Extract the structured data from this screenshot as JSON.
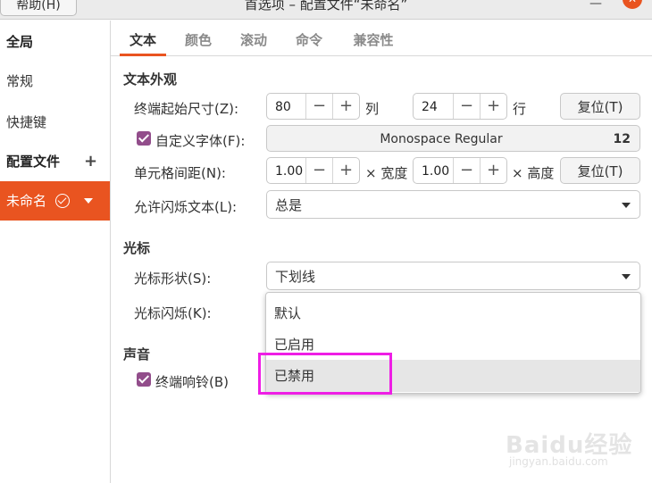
{
  "window": {
    "help_menu": "帮助(H)",
    "title": "首选项 – 配置文件“未命名”",
    "minimize_glyph": "—",
    "close_glyph": "✕"
  },
  "sidebar": {
    "global_header": "全局",
    "general": "常规",
    "shortcuts": "快捷键",
    "profiles_header": "配置文件",
    "add_glyph": "+",
    "profile_selected": "未命名"
  },
  "tabs": [
    "文本",
    "颜色",
    "滚动",
    "命令",
    "兼容性"
  ],
  "text_appearance": {
    "section_title": "文本外观",
    "initial_size_label": "终端起始尺寸(Z):",
    "columns_value": "80",
    "columns_unit": "列",
    "rows_value": "24",
    "rows_unit": "行",
    "reset_size_button": "复位(T)",
    "custom_font_label": "自定义字体(F):",
    "custom_font_checked": true,
    "font_name": "Monospace Regular",
    "font_size": "12",
    "cell_spacing_label": "单元格间距(N):",
    "width_value": "1.00",
    "width_unit": "× 宽度",
    "height_value": "1.00",
    "height_unit": "× 高度",
    "reset_spacing_button": "复位(T)",
    "blink_text_label": "允许闪烁文本(L):",
    "blink_text_value": "总是"
  },
  "cursor": {
    "section_title": "光标",
    "shape_label": "光标形状(S):",
    "shape_value": "下划线",
    "blink_label": "光标闪烁(K):",
    "blink_options": [
      "默认",
      "已启用",
      "已禁用"
    ],
    "hovered_option": "已禁用"
  },
  "sound": {
    "section_title": "声音",
    "bell_label": "终端响铃(B)",
    "bell_checked": true
  },
  "spin_glyphs": {
    "minus": "−",
    "plus": "+"
  },
  "watermark": {
    "brand": "Baidu经验",
    "url": "jingyan.baidu.com"
  },
  "colors": {
    "accent": "#e95420",
    "checkbox": "#924d8b",
    "highlight_box": "#ee1ee5"
  }
}
